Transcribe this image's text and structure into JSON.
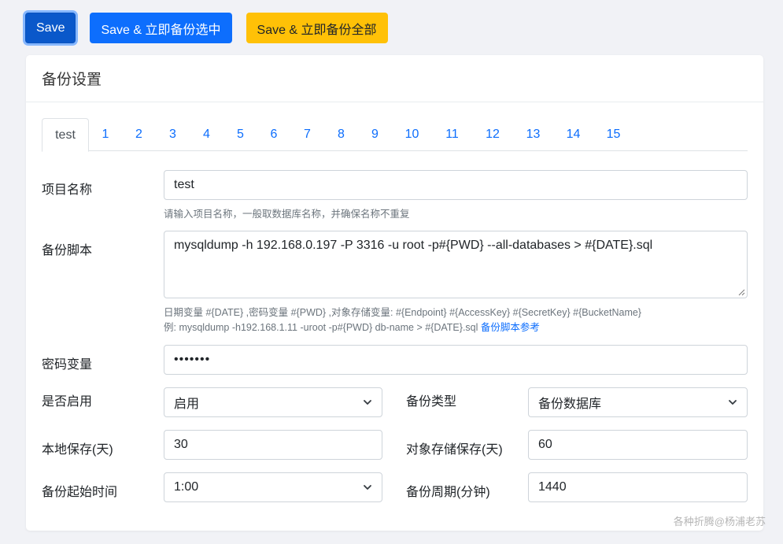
{
  "toolbar": {
    "save_label": "Save",
    "save_backup_selected_label": "Save & 立即备份选中",
    "save_backup_all_label": "Save & 立即备份全部"
  },
  "card": {
    "title": "备份设置"
  },
  "tabs": [
    {
      "label": "test"
    },
    {
      "label": "1"
    },
    {
      "label": "2"
    },
    {
      "label": "3"
    },
    {
      "label": "4"
    },
    {
      "label": "5"
    },
    {
      "label": "6"
    },
    {
      "label": "7"
    },
    {
      "label": "8"
    },
    {
      "label": "9"
    },
    {
      "label": "10"
    },
    {
      "label": "11"
    },
    {
      "label": "12"
    },
    {
      "label": "13"
    },
    {
      "label": "14"
    },
    {
      "label": "15"
    }
  ],
  "form": {
    "project_name": {
      "label": "项目名称",
      "value": "test",
      "help": "请输入项目名称，一般取数据库名称，并确保名称不重复"
    },
    "backup_script": {
      "label": "备份脚本",
      "value": "mysqldump -h 192.168.0.197 -P 3316 -u root -p#{PWD} --all-databases > #{DATE}.sql",
      "help_vars": "日期变量 #{DATE} ,密码变量 #{PWD} ,对象存储变量: #{Endpoint} #{AccessKey} #{SecretKey} #{BucketName}",
      "help_example": "例: mysqldump -h192.168.1.11 -uroot -p#{PWD} db-name > #{DATE}.sql ",
      "help_link": "备份脚本参考"
    },
    "password": {
      "label": "密码变量",
      "value": "•••••••"
    },
    "enabled": {
      "label": "是否启用",
      "value": "启用"
    },
    "backup_type": {
      "label": "备份类型",
      "value": "备份数据库"
    },
    "local_retention": {
      "label": "本地保存(天)",
      "value": "30"
    },
    "object_retention": {
      "label": "对象存储保存(天)",
      "value": "60"
    },
    "start_time": {
      "label": "备份起始时间",
      "value": "1:00"
    },
    "period": {
      "label": "备份周期(分钟)",
      "value": "1440"
    }
  },
  "watermark": "各种折腾@杨浦老苏"
}
